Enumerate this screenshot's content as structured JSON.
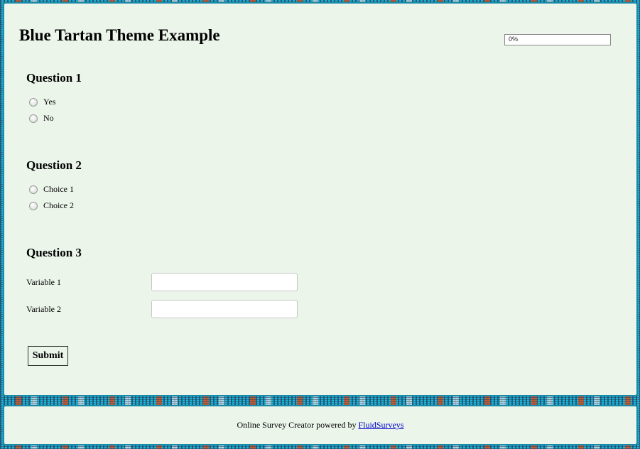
{
  "survey": {
    "title": "Blue Tartan Theme Example",
    "progress": {
      "text": "0%",
      "value": 0
    }
  },
  "questions": [
    {
      "title": "Question 1",
      "options": [
        "Yes",
        "No"
      ]
    },
    {
      "title": "Question 2",
      "options": [
        "Choice 1",
        "Choice 2"
      ]
    },
    {
      "title": "Question 3",
      "fields": [
        {
          "label": "Variable 1",
          "value": ""
        },
        {
          "label": "Variable 2",
          "value": ""
        }
      ]
    }
  ],
  "actions": {
    "submit_label": "Submit"
  },
  "footer": {
    "text": "Online Survey Creator powered by ",
    "link_text": "FluidSurveys"
  },
  "colors": {
    "panel_background": "#ebf5ea",
    "panel_border": "#1a8aa8",
    "page_background": "#16b7d8",
    "link": "#0000cc"
  }
}
